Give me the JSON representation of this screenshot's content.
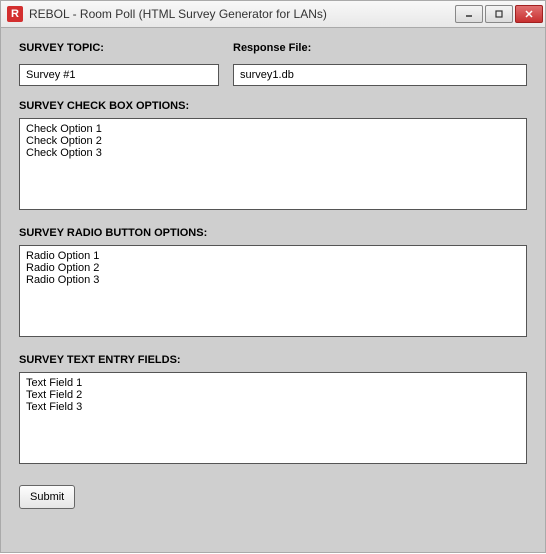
{
  "window": {
    "title": "REBOL - Room Poll (HTML Survey Generator for LANs)"
  },
  "labels": {
    "survey_topic": "SURVEY TOPIC:",
    "response_file": "Response File:",
    "checkbox_options": "SURVEY CHECK BOX OPTIONS:",
    "radio_options": "SURVEY RADIO BUTTON OPTIONS:",
    "text_fields": "SURVEY TEXT ENTRY FIELDS:"
  },
  "fields": {
    "survey_topic_value": "Survey #1",
    "response_file_value": "survey1.db",
    "checkbox_options_value": "Check Option 1\nCheck Option 2\nCheck Option 3",
    "radio_options_value": "Radio Option 1\nRadio Option 2\nRadio Option 3",
    "text_fields_value": "Text Field 1\nText Field 2\nText Field 3"
  },
  "buttons": {
    "submit": "Submit"
  }
}
